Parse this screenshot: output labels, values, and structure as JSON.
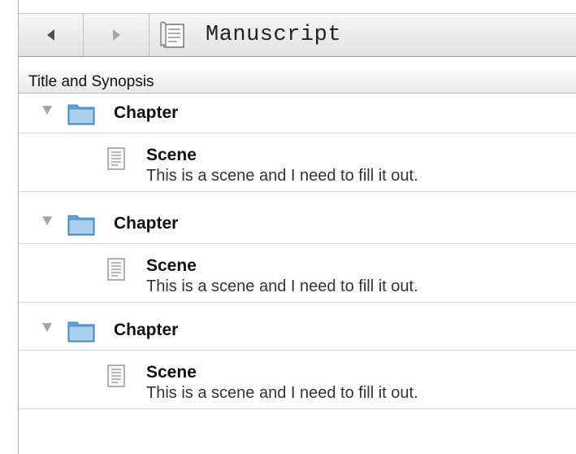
{
  "header": {
    "back_icon": "back-arrow-icon",
    "forward_icon": "forward-arrow-icon",
    "document_icon": "manuscript-document-icon",
    "title": "Manuscript"
  },
  "column_header": {
    "label": "Title and Synopsis"
  },
  "outline": {
    "items": [
      {
        "chapter": {
          "label": "Chapter",
          "icon": "folder-icon",
          "expanded": true
        },
        "scene": {
          "title": "Scene",
          "synopsis": "This is a scene and I need to fill it out.",
          "icon": "text-document-icon"
        }
      },
      {
        "chapter": {
          "label": "Chapter",
          "icon": "folder-icon",
          "expanded": true
        },
        "scene": {
          "title": "Scene",
          "synopsis": "This is a scene and I need to fill it out.",
          "icon": "text-document-icon"
        }
      },
      {
        "chapter": {
          "label": "Chapter",
          "icon": "folder-icon",
          "expanded": true
        },
        "scene": {
          "title": "Scene",
          "synopsis": "This is a scene and I need to fill it out.",
          "icon": "text-document-icon"
        }
      }
    ]
  },
  "colors": {
    "folder_blue": "#5fa4d6",
    "folder_light": "#a9d1ee",
    "header_border": "#9e9e9e",
    "row_divider": "#d4d4d4"
  }
}
